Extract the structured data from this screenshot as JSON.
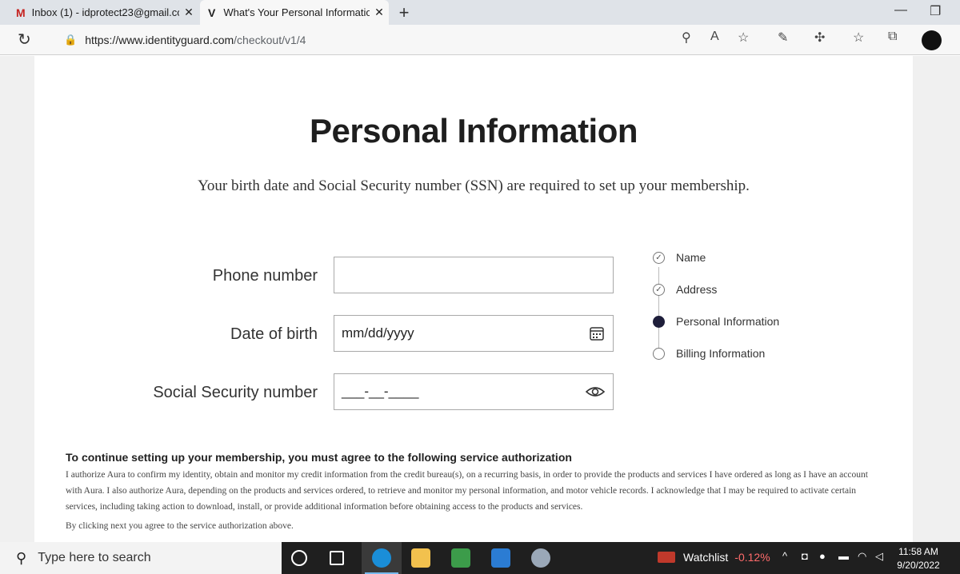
{
  "browser": {
    "tabs": [
      {
        "label": "Inbox (1) - idprotect23@gmail.co"
      },
      {
        "label": "What's Your Personal Informatio"
      }
    ],
    "url_host": "https://www.identityguard.com",
    "url_path": "/checkout/v1/4"
  },
  "page": {
    "title": "Personal Information",
    "subtitle": "Your birth date and Social Security number (SSN) are required to set up your membership.",
    "fields": {
      "phone": {
        "label": "Phone number",
        "value": ""
      },
      "dob": {
        "label": "Date of birth",
        "placeholder": "mm/dd/yyyy"
      },
      "ssn": {
        "label": "Social Security number",
        "placeholder": "___-__-____"
      }
    },
    "steps": [
      {
        "label": "Name",
        "state": "done"
      },
      {
        "label": "Address",
        "state": "done"
      },
      {
        "label": "Personal Information",
        "state": "current"
      },
      {
        "label": "Billing Information",
        "state": "pending"
      }
    ],
    "authorization": {
      "heading": "To continue setting up your membership, you must agree to the following service authorization",
      "body": "I authorize Aura to confirm my identity, obtain and monitor my credit information from the credit bureau(s), on a recurring basis, in order to provide the products and services I have ordered as long as I have an account with Aura. I also authorize Aura, depending on the products and services ordered, to retrieve and monitor my personal information, and motor vehicle records. I acknowledge that I may be required to activate certain services, including taking action to download, install, or provide additional information before obtaining access to the products and services.",
      "note": "By clicking next you agree to the service authorization above."
    }
  },
  "taskbar": {
    "search_placeholder": "Type here to search",
    "watchlist_label": "Watchlist",
    "watchlist_change": "-0.12%",
    "time": "11:58 AM",
    "date": "9/20/2022"
  },
  "colors": {
    "step_active": "#1e1e3a",
    "taskbar": "#1f1f1f",
    "watchlist_negative": "#ff6b6b"
  }
}
